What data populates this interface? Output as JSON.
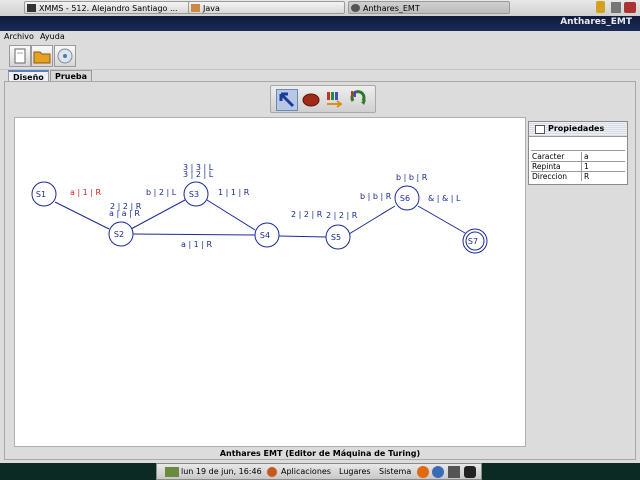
{
  "taskbar_top": {
    "tasks": [
      {
        "label": "XMMS - 512. Alejandro Santiago ..."
      },
      {
        "label": "Java"
      },
      {
        "label": "Anthares_EMT"
      }
    ]
  },
  "window": {
    "title": "Anthares_EMT"
  },
  "menubar": {
    "items": [
      "Archivo",
      "Ayuda"
    ]
  },
  "tabs": [
    {
      "label": "Diseño"
    },
    {
      "label": "Prueba"
    }
  ],
  "properties": {
    "title": "Propiedades",
    "rows": [
      {
        "key": "Caracter",
        "value": "a"
      },
      {
        "key": "Repinta",
        "value": "1"
      },
      {
        "key": "Direccion",
        "value": "R"
      }
    ]
  },
  "diagram": {
    "states": [
      "S1",
      "S2",
      "S3",
      "S4",
      "S5",
      "S6",
      "S7"
    ],
    "accepting_state": "S7",
    "transitions": [
      {
        "label": "a | 1 | R",
        "color": "#cc2222"
      },
      {
        "label": "2 | 2 | R",
        "color": "#1a2a9a"
      },
      {
        "label": "a | a | R",
        "color": "#1a2a9a"
      },
      {
        "label": "b | 2 | L",
        "color": "#1a2a9a"
      },
      {
        "label": "3 | 3 | L",
        "color": "#1a2a9a"
      },
      {
        "label": "3 | 2 | L",
        "color": "#1a2a9a"
      },
      {
        "label": "1 | 1 | R",
        "color": "#1a2a9a"
      },
      {
        "label": "a | 1 | R",
        "color": "#1a2a9a"
      },
      {
        "label": "2 | 2 | R",
        "color": "#1a2a9a"
      },
      {
        "label": "2 | 2 | R",
        "color": "#1a2a9a"
      },
      {
        "label": "b | b | R",
        "color": "#1a2a9a"
      },
      {
        "label": "b | b | R",
        "color": "#1a2a9a"
      },
      {
        "label": "& | & | L",
        "color": "#1a2a9a"
      }
    ]
  },
  "status": {
    "text": "Anthares EMT (Editor de Máquina de Turing)"
  },
  "bottom_panel": {
    "clock": "lun 19 de jun, 16:46",
    "menus": [
      "Aplicaciones",
      "Lugares",
      "Sistema"
    ]
  },
  "colors": {
    "edge": "#1a2a9a",
    "state": "#1a2a9a",
    "accent": "#cc2222"
  }
}
